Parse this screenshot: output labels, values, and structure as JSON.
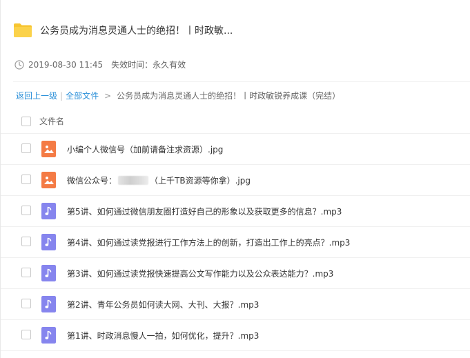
{
  "share": {
    "title": "公务员成为消息灵通人士的绝招！丨时政敏...",
    "created_at": "2019-08-30 11:45",
    "expire_label": "失效时间：永久有效"
  },
  "breadcrumb": {
    "back_label": "返回上一级",
    "pipe": "|",
    "all_files_label": "全部文件",
    "arrow": ">",
    "current": "公务员成为消息灵通人士的绝招！丨时政敏锐养成课（完结）"
  },
  "list": {
    "column_name": "文件名",
    "files": [
      {
        "type": "image",
        "name": "小编个人微信号（加前请备注求资源）.jpg"
      },
      {
        "type": "image",
        "name_before": "微信公众号：",
        "name_after": "（上千TB资源等你拿）.jpg"
      },
      {
        "type": "audio",
        "name": "第5讲、如何通过微信朋友圈打造好自己的形象以及获取更多的信息？.mp3"
      },
      {
        "type": "audio",
        "name": "第4讲、如何通过读党报进行工作方法上的创新，打造出工作上的亮点？.mp3"
      },
      {
        "type": "audio",
        "name": "第3讲、如何通过读党报快速提高公文写作能力以及公众表达能力？.mp3"
      },
      {
        "type": "audio",
        "name": "第2讲、青年公务员如何读大网、大刊、大报？.mp3"
      },
      {
        "type": "audio",
        "name": "第1讲、时政消息慢人一拍，如何优化，提升？.mp3"
      }
    ]
  },
  "icons": {
    "folder": "folder-icon",
    "clock": "clock-icon",
    "image_file": "image-file-icon",
    "audio_file": "audio-file-icon"
  },
  "colors": {
    "link": "#2b90d9",
    "folder": "#f7c531",
    "image_icon": "#f47b45",
    "audio_icon": "#8685ee"
  }
}
